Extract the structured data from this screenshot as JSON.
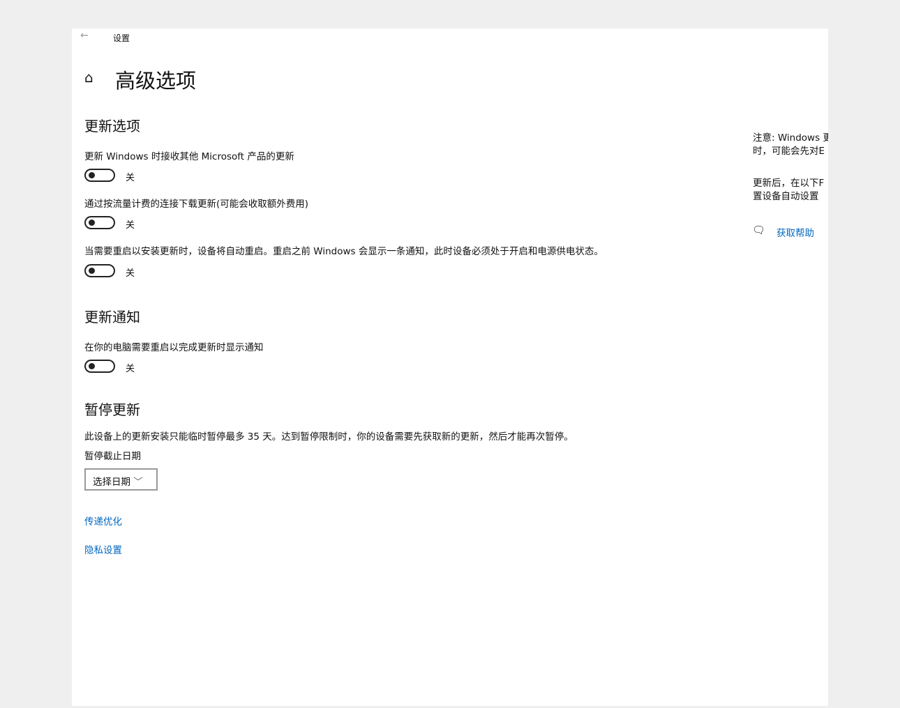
{
  "window": {
    "back_icon": "arrow-left",
    "title": "设置"
  },
  "page": {
    "home_icon": "home",
    "title": "高级选项"
  },
  "update_options": {
    "heading": "更新选项",
    "items": [
      {
        "label": "更新 Windows 时接收其他 Microsoft 产品的更新",
        "state": "关"
      },
      {
        "label": "通过按流量计费的连接下载更新(可能会收取额外费用)",
        "state": "关"
      },
      {
        "label": "当需要重启以安装更新时，设备将自动重启。重启之前 Windows 会显示一条通知，此时设备必须处于开启和电源供电状态。",
        "state": "关"
      }
    ]
  },
  "notifications": {
    "heading": "更新通知",
    "items": [
      {
        "label": "在你的电脑需要重启以完成更新时显示通知",
        "state": "关"
      }
    ]
  },
  "pause": {
    "heading": "暂停更新",
    "description": "此设备上的更新安装只能临时暂停最多 35 天。达到暂停限制时，你的设备需要先获取新的更新，然后才能再次暂停。",
    "date_label": "暂停截止日期",
    "date_select": "选择日期"
  },
  "links": {
    "delivery": "传递优化",
    "privacy": "隐私设置"
  },
  "sidebar": {
    "note_line1": "注意: Windows 更",
    "note_line2": "时，可能会先对E",
    "note2_line1": "更新后，在以下F",
    "note2_line2": "置设备自动设置",
    "help_icon": "chat-help",
    "help": "获取帮助"
  },
  "colors": {
    "link": "#0067c0"
  }
}
